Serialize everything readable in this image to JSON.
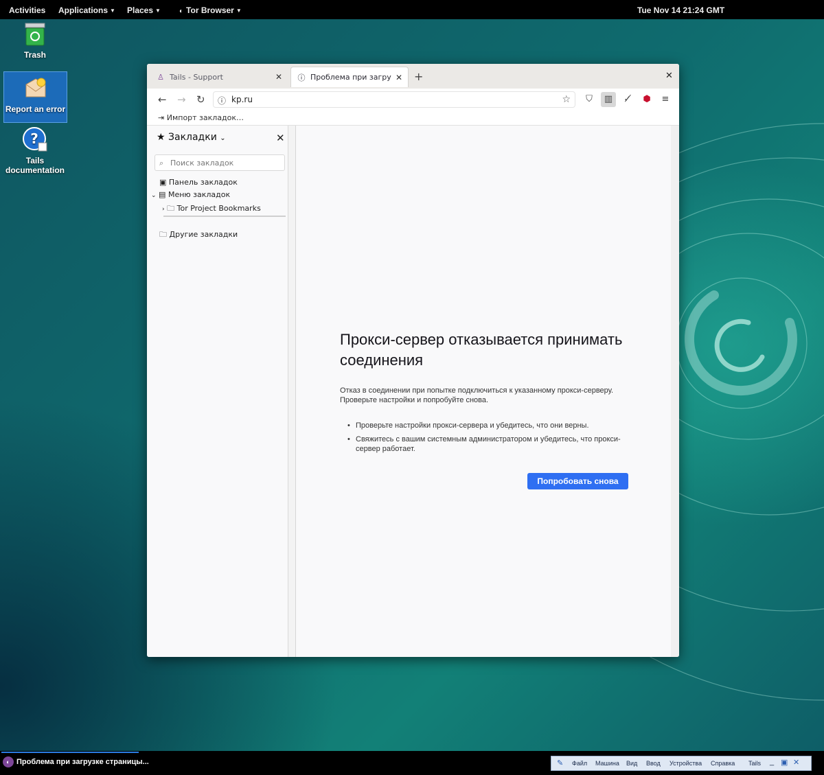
{
  "topbar": {
    "activities": "Activities",
    "applications": "Applications",
    "places": "Places",
    "tor_browser": "Tor Browser",
    "clock": "Tue Nov 14  21:24 GMT"
  },
  "desktop_icons": {
    "trash": "Trash",
    "report": "Report an error",
    "docs_line1": "Tails",
    "docs_line2": "documentation"
  },
  "browser": {
    "tabs": [
      {
        "label": "Tails - Support",
        "active": false
      },
      {
        "label": "Проблема при загрузке страницы",
        "active": true
      }
    ],
    "url": "kp.ru",
    "bookmarks_toolbar": {
      "import": "Импорт закладок…"
    },
    "sidebar": {
      "title": "Закладки",
      "search_placeholder": "Поиск закладок",
      "items": [
        {
          "label": "Панель закладок"
        },
        {
          "label": "Меню закладок"
        },
        {
          "label": "Tor Project Bookmarks"
        },
        {
          "label": "Другие закладки"
        }
      ]
    },
    "error": {
      "title": "Прокси-сервер отказывается принимать соединения",
      "description": "Отказ в соединении при попытке подключиться к указанному прокси-серверу. Проверьте настройки и попробуйте снова.",
      "bullets": [
        "Проверьте настройки прокси-сервера и убедитесь, что они верны.",
        "Свяжитесь с вашим системным администратором и убедитесь, что прокси-сервер работает."
      ],
      "retry_button": "Попробовать снова"
    }
  },
  "taskbar": {
    "window_title": "Проблема при загрузке страницы..."
  },
  "vm_toolbar": {
    "menus": [
      "Файл",
      "Машина",
      "Вид",
      "Ввод",
      "Устройства",
      "Справка"
    ],
    "tails": "Tails"
  },
  "colors": {
    "accent_button": "#2f6ff2",
    "desktop_teal": "#0f6b6e",
    "selection_blue": "#1e6ec8"
  }
}
